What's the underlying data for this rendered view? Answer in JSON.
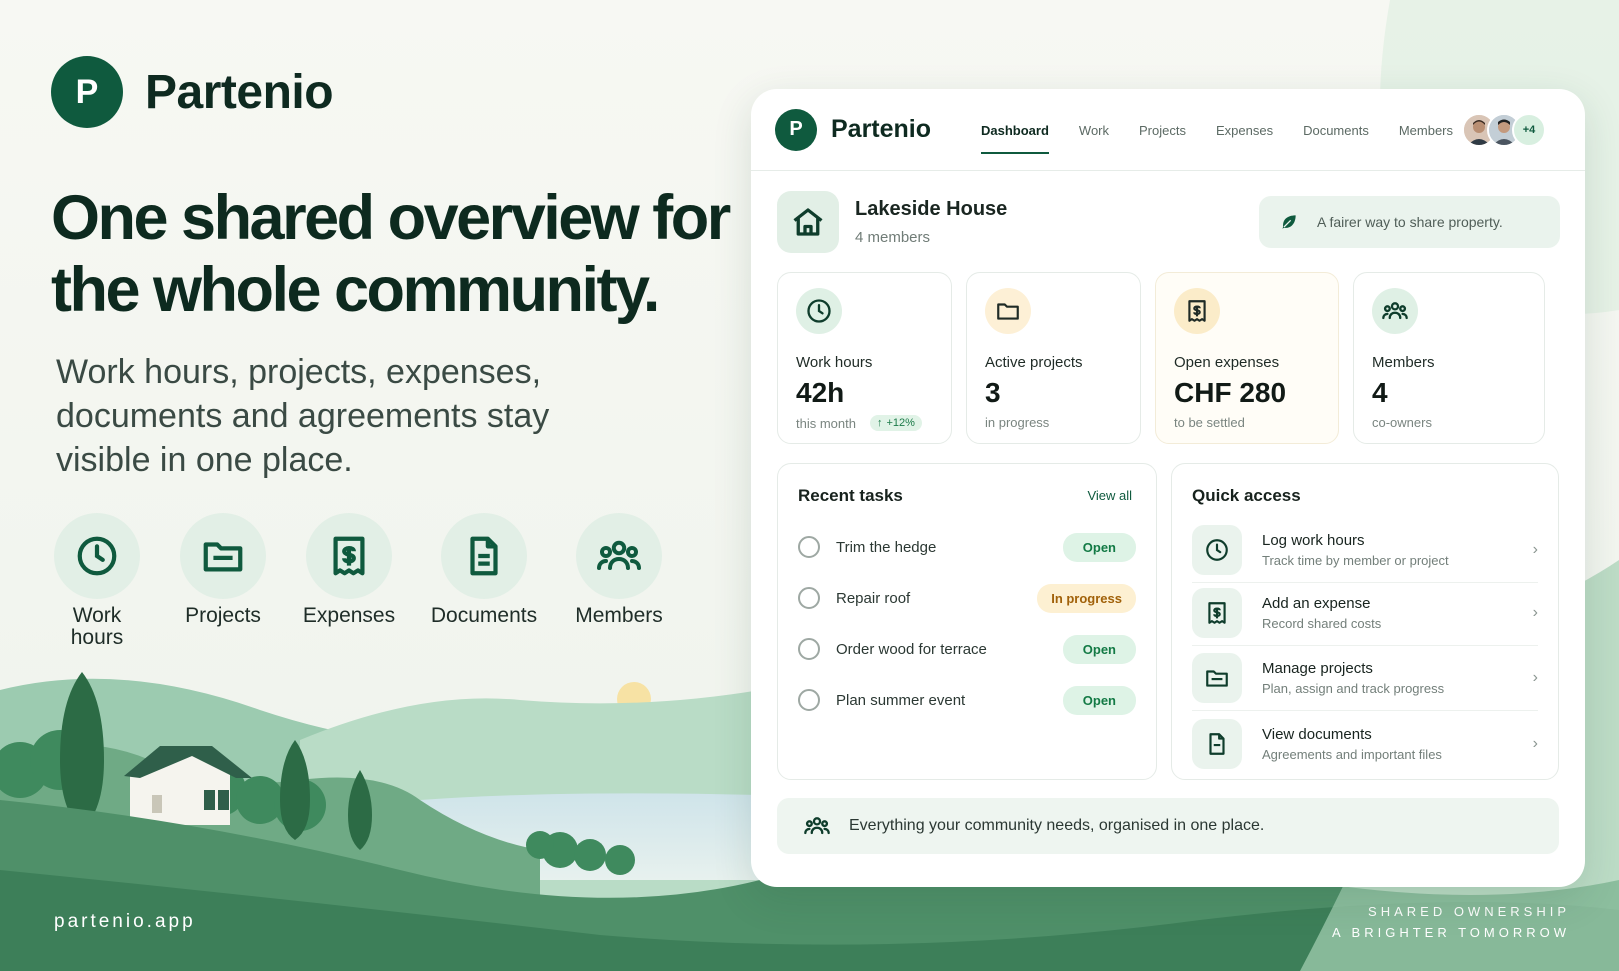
{
  "brand": {
    "logo_letter": "P",
    "name": "Partenio"
  },
  "hero": {
    "headline": "One shared overview for the whole community.",
    "subline": "Work hours, projects, expenses, documents and agreements stay visible in one place.",
    "features": [
      {
        "label": "Work hours",
        "icon": "clock-icon"
      },
      {
        "label": "Projects",
        "icon": "folder-icon"
      },
      {
        "label": "Expenses",
        "icon": "receipt-icon"
      },
      {
        "label": "Documents",
        "icon": "document-icon"
      },
      {
        "label": "Members",
        "icon": "members-icon"
      }
    ],
    "site_url": "partenio.app",
    "tagline_line1": "SHARED OWNERSHIP",
    "tagline_line2": "A BRIGHTER TOMORROW"
  },
  "app": {
    "nav": {
      "logo_letter": "P",
      "brand": "Partenio",
      "tabs": [
        "Dashboard",
        "Work",
        "Projects",
        "Expenses",
        "Documents",
        "Members"
      ],
      "active_tab": "Dashboard",
      "avatar_more": "+4"
    },
    "property": {
      "title": "Lakeside House",
      "subtitle": "4 members"
    },
    "motto": "A fairer way to share property.",
    "stats": [
      {
        "label": "Work hours",
        "value": "42h",
        "note": "this month",
        "trend": "+12%"
      },
      {
        "label": "Active projects",
        "value": "3",
        "note": "in progress"
      },
      {
        "label": "Open expenses",
        "value": "CHF 280",
        "note": "to be settled"
      },
      {
        "label": "Members",
        "value": "4",
        "note": "co-owners"
      }
    ],
    "tasks": {
      "title": "Recent tasks",
      "view_all": "View all",
      "items": [
        {
          "label": "Trim the hedge",
          "status": "Open"
        },
        {
          "label": "Repair roof",
          "status": "In progress"
        },
        {
          "label": "Order wood for terrace",
          "status": "Open"
        },
        {
          "label": "Plan summer event",
          "status": "Open"
        }
      ]
    },
    "quick": {
      "title": "Quick access",
      "items": [
        {
          "title": "Log work hours",
          "subtitle": "Track time by member or project"
        },
        {
          "title": "Add an expense",
          "subtitle": "Record shared costs"
        },
        {
          "title": "Manage projects",
          "subtitle": "Plan, assign and track progress"
        },
        {
          "title": "View documents",
          "subtitle": "Agreements and important files"
        }
      ]
    },
    "footer": "Everything your community needs, organised in one place."
  },
  "colors": {
    "primary": "#0f5a3e",
    "accent_light": "#e2efe6",
    "warning_bg": "#fdf0d2",
    "warning_text": "#a16109"
  }
}
